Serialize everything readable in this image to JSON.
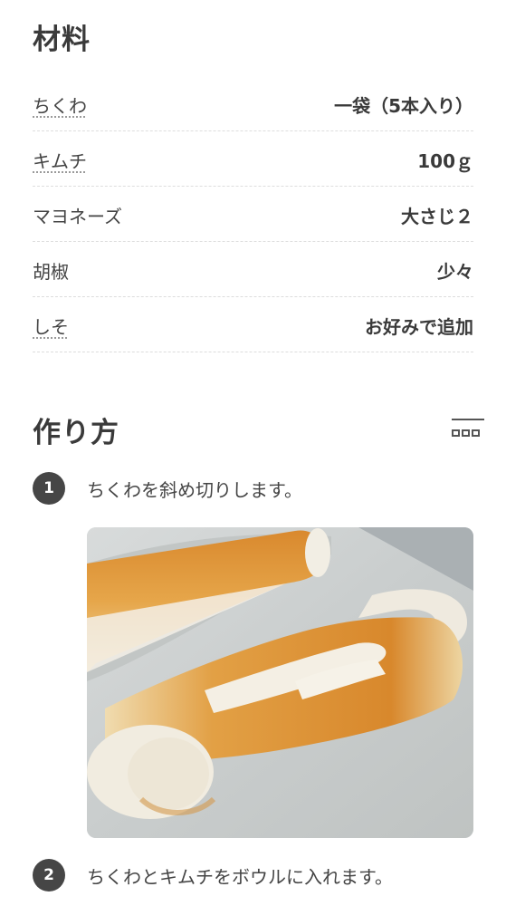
{
  "ingredients": {
    "title": "材料",
    "items": [
      {
        "name": "ちくわ",
        "amount": "一袋（5本入り）"
      },
      {
        "name": "キムチ",
        "amount": "100ｇ"
      },
      {
        "name": "マヨネーズ",
        "amount": "大さじ２"
      },
      {
        "name": "胡椒",
        "amount": "少々"
      },
      {
        "name": "しそ",
        "amount": "お好みで追加"
      }
    ]
  },
  "steps": {
    "title": "作り方",
    "toggle_icon": "grid-layout-icon",
    "items": [
      {
        "number": "1",
        "text": "ちくわを斜め切りします。",
        "image": "sliced-chikuwa-photo"
      },
      {
        "number": "2",
        "text": "ちくわとキムチをボウルに入れます。"
      }
    ]
  }
}
